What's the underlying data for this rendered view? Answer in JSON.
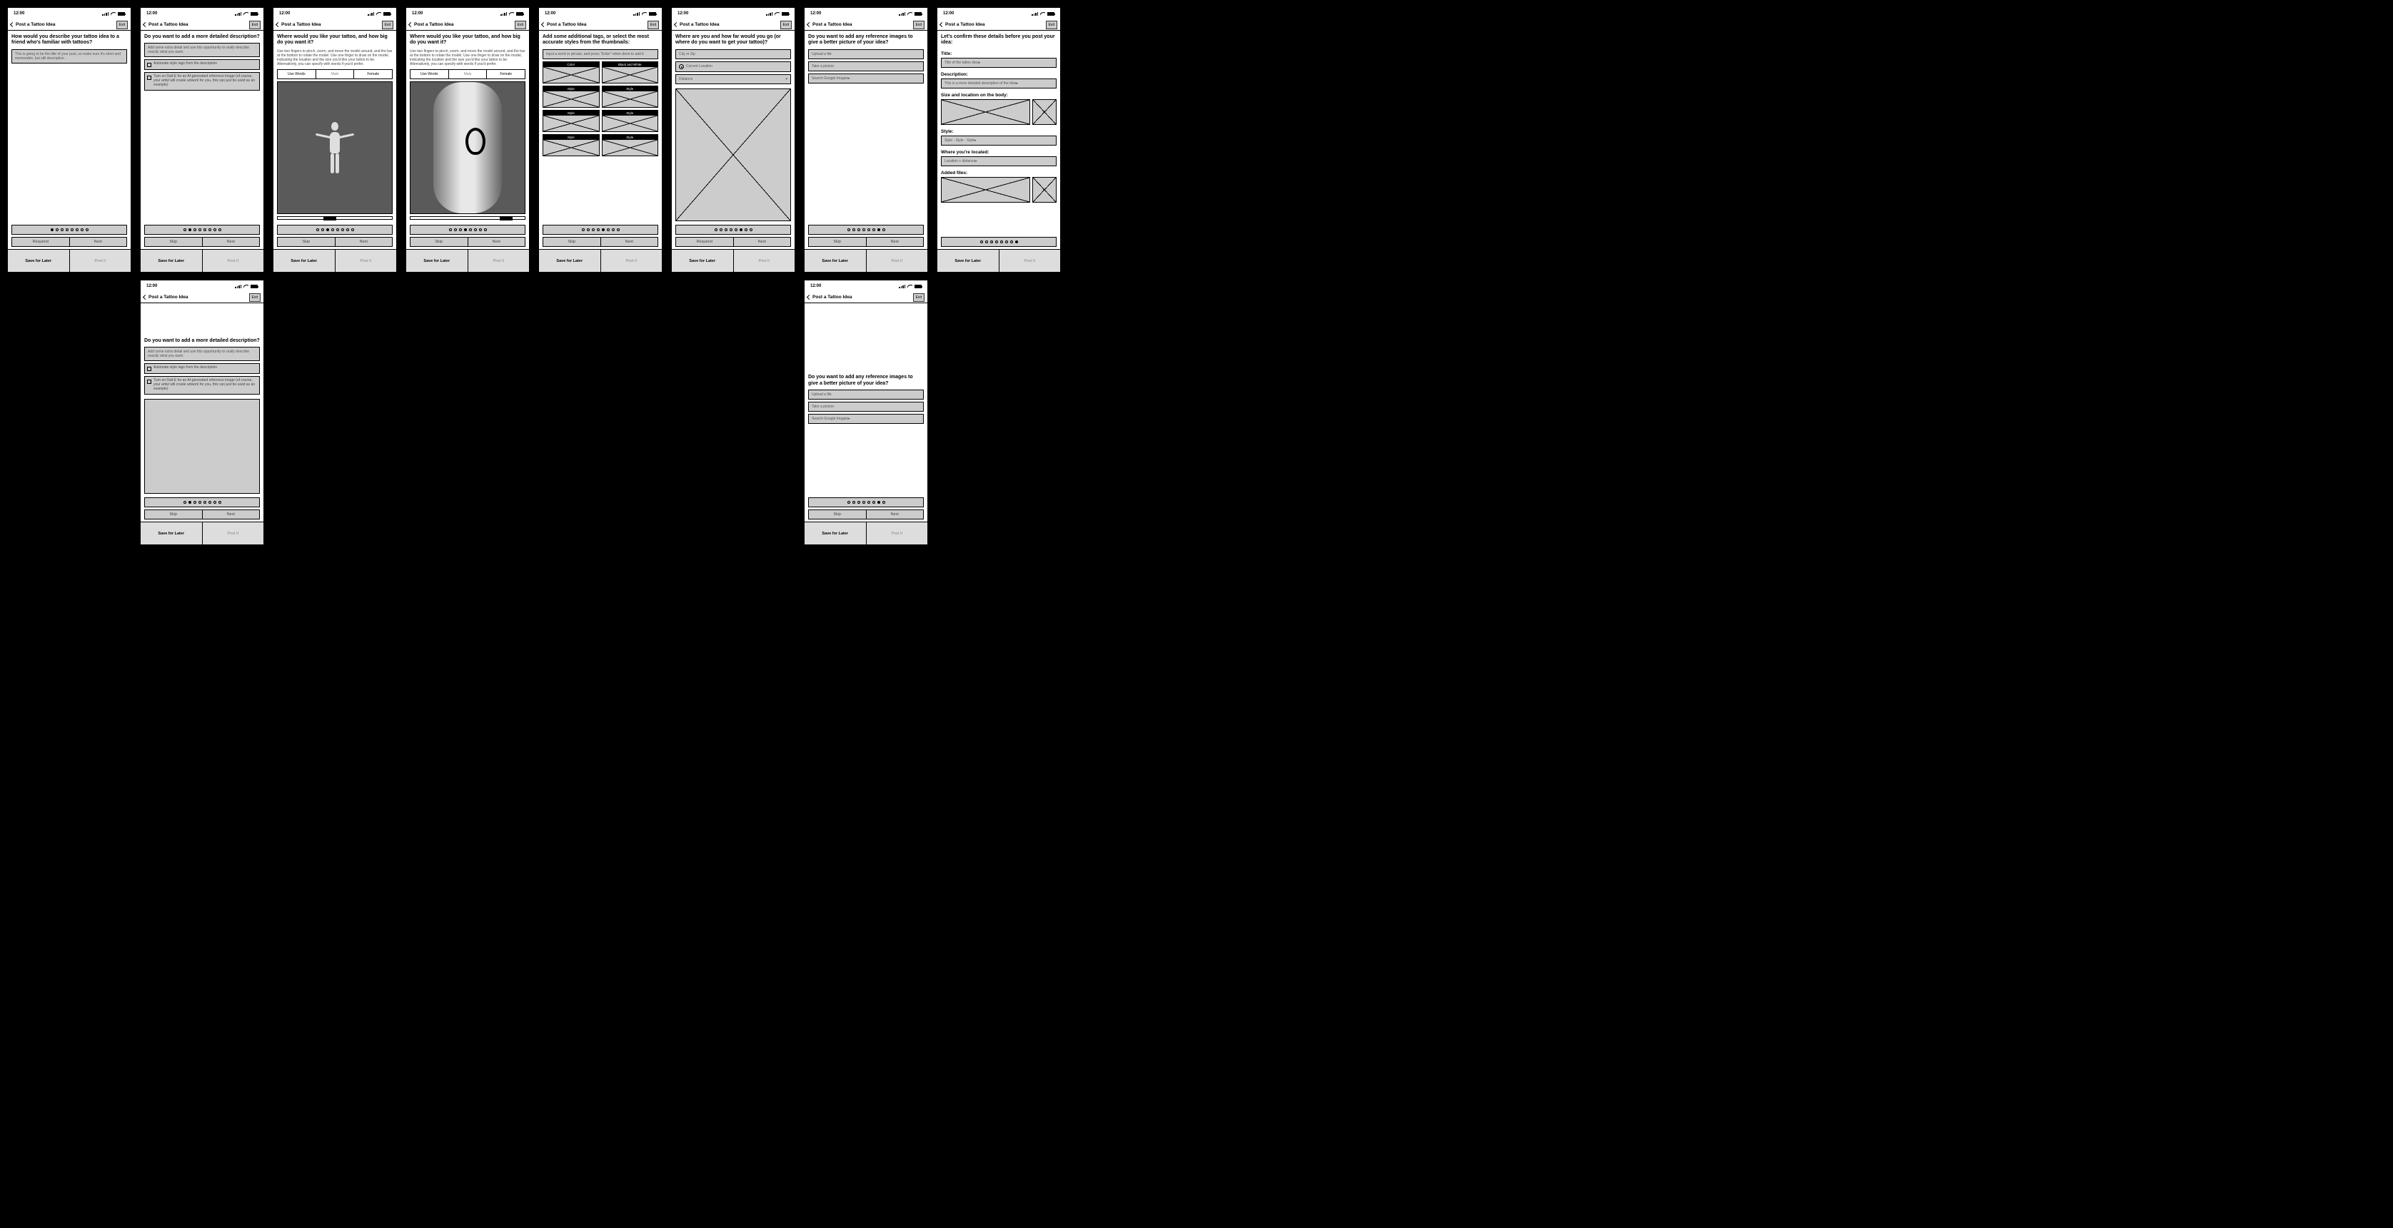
{
  "status": {
    "time": "12:00"
  },
  "nav": {
    "title": "Post a Tattoo Idea",
    "exit": "Exit"
  },
  "footer": {
    "save": "Save for Later",
    "post": "Post It"
  },
  "btns": {
    "skip": "Skip",
    "next": "Next",
    "required": "Required",
    "usewords": "Use Words",
    "male": "Male",
    "female": "Female"
  },
  "s1": {
    "prompt": "How would you describe your tattoo idea to a friend who's familiar with tattoos?",
    "field": "This is going to be the title of your post, so make sure it's short and memorable, but still descriptive."
  },
  "s2": {
    "prompt": "Do you want to add a more detailed description?",
    "field": "Add some extra detail and use this opportunity to really describe exactly what you want.",
    "check1": "Automate style tags from the description",
    "check2": "Turn on Dall-E for an AI-generated reference image (of course, your artist will create artwork for you, this can just be used as an example)"
  },
  "s3": {
    "prompt": "Where would you like your tattoo, and how big do you want it?",
    "sub": "Use two fingers to pinch, zoom, and move the model around, and the bar at the bottom to rotate the model. Use one finger to draw on the model, indicating the location and the size you'd like your tattoo to be. Alternatively, you can specify with words if you'd prefer."
  },
  "s5": {
    "prompt": "Add some additional tags, or select the most accurate styles from the thumbnails:",
    "field": "Input a word or phrase, and press \"Enter\" when done to add it",
    "cats": [
      "Color",
      "Black and White",
      "Style",
      "Style",
      "Style",
      "Style",
      "Style",
      "Style"
    ]
  },
  "s6": {
    "prompt": "Where are you and how far would you go (or where do you want to get your tattoo)?",
    "city": "City or Zip",
    "loc": "Current Location",
    "dist": "Distance"
  },
  "s7": {
    "prompt": "Do you want to add any reference images to give a better picture of your idea?",
    "upload": "Upload a file",
    "take": "Take a picture",
    "search": "Search Google Images"
  },
  "s8": {
    "prompt": "Let's confirm these details before you post your idea:",
    "title_lbl": "Title:",
    "title_val": "Title of the tattoo idea",
    "desc_lbl": "Description:",
    "desc_val": "This is a more detailed description of the idea",
    "size_lbl": "Size and location on the body:",
    "style_lbl": "Style:",
    "style_val": "Style · Style · Style",
    "loc_lbl": "Where you're located:",
    "loc_val": "Location + distance",
    "files_lbl": "Added files:"
  }
}
